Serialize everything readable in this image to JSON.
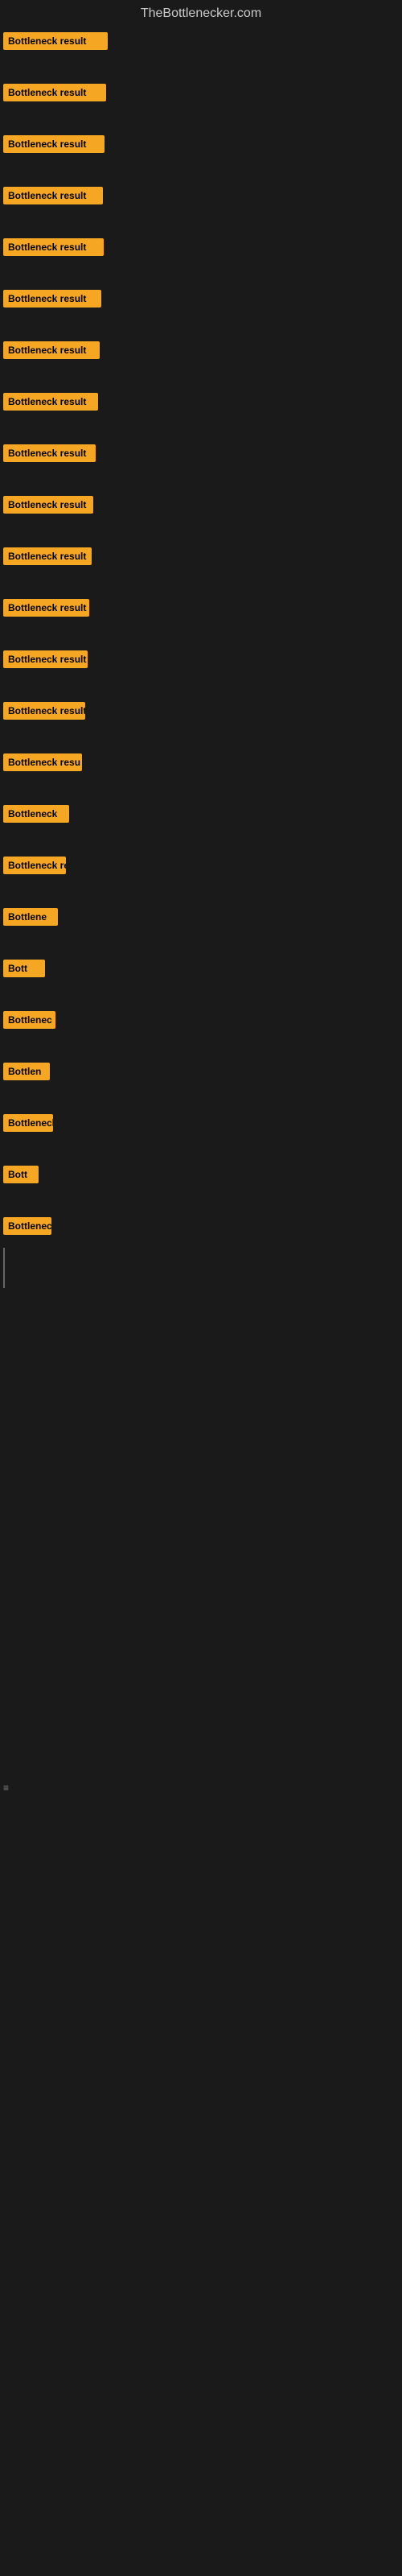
{
  "site": {
    "title": "TheBottlenecker.com"
  },
  "colors": {
    "badge_bg": "#f5a623",
    "badge_text": "#000000",
    "page_bg": "#1a1a1a"
  },
  "rows": [
    {
      "id": 1,
      "label": "Bottleneck result"
    },
    {
      "id": 2,
      "label": "Bottleneck result"
    },
    {
      "id": 3,
      "label": "Bottleneck result"
    },
    {
      "id": 4,
      "label": "Bottleneck result"
    },
    {
      "id": 5,
      "label": "Bottleneck result"
    },
    {
      "id": 6,
      "label": "Bottleneck result"
    },
    {
      "id": 7,
      "label": "Bottleneck result"
    },
    {
      "id": 8,
      "label": "Bottleneck result"
    },
    {
      "id": 9,
      "label": "Bottleneck result"
    },
    {
      "id": 10,
      "label": "Bottleneck result"
    },
    {
      "id": 11,
      "label": "Bottleneck result"
    },
    {
      "id": 12,
      "label": "Bottleneck result"
    },
    {
      "id": 13,
      "label": "Bottleneck result"
    },
    {
      "id": 14,
      "label": "Bottleneck result"
    },
    {
      "id": 15,
      "label": "Bottleneck resu"
    },
    {
      "id": 16,
      "label": "Bottleneck"
    },
    {
      "id": 17,
      "label": "Bottleneck re"
    },
    {
      "id": 18,
      "label": "Bottlene"
    },
    {
      "id": 19,
      "label": "Bott"
    },
    {
      "id": 20,
      "label": "Bottlenec"
    },
    {
      "id": 21,
      "label": "Bottlen"
    },
    {
      "id": 22,
      "label": "Bottleneck"
    },
    {
      "id": 23,
      "label": "Bott"
    },
    {
      "id": 24,
      "label": "Bottlenec"
    }
  ],
  "bottom_marker": {
    "text": "≡"
  }
}
